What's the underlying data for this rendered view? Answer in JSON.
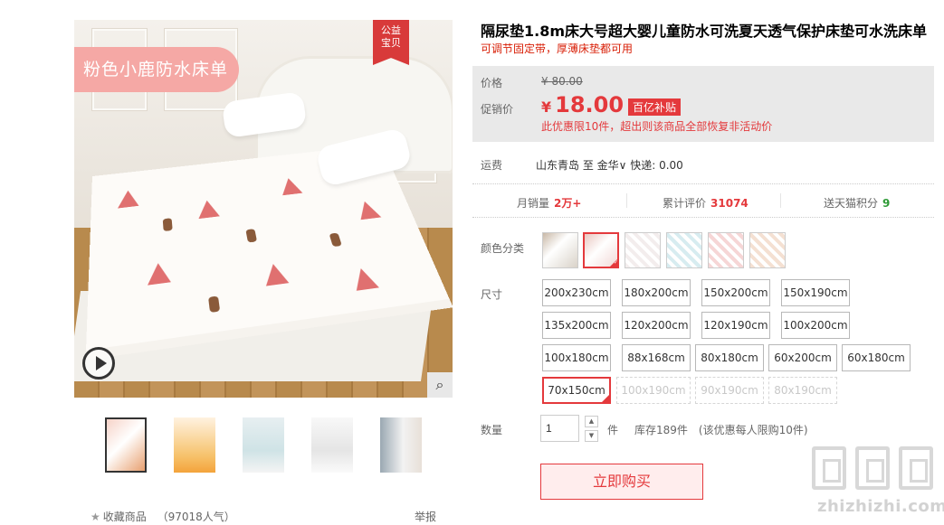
{
  "gallery": {
    "banner_text": "粉色小鹿防水床单",
    "charity_badge": [
      "公益",
      "宝贝"
    ],
    "thumbnails": 5,
    "active_thumbnail": 0,
    "favorite_label": "收藏商品",
    "favorite_count": "（97018人气）",
    "report_label": "举报",
    "play_icon": "play-icon",
    "zoom_icon": "magnifier-icon"
  },
  "product": {
    "title": "隔尿垫1.8m床大号超大婴儿童防水可洗夏天透气保护床垫可水洗床单",
    "subtitle": "可调节固定带，厚薄床垫都可用"
  },
  "price": {
    "orig_label": "价格",
    "orig_value": "¥ 80.00",
    "promo_label": "促销价",
    "currency": "¥",
    "promo_value": "18.00",
    "subsidy_badge": "百亿补贴",
    "limit_note": "此优惠限10件，超出则该商品全部恢复非活动价",
    "accent_color": "#e4393c"
  },
  "shipping": {
    "label": "运费",
    "text": "山东青岛 至 金华∨ 快递: 0.00"
  },
  "stats": [
    {
      "label": "月销量",
      "value": "2万+",
      "color": "red"
    },
    {
      "label": "累计评价",
      "value": "31074",
      "color": "red"
    },
    {
      "label": "送天猫积分",
      "value": "9",
      "color": "green"
    }
  ],
  "color": {
    "label": "颜色分类",
    "swatches": [
      "swatch-1",
      "swatch-2",
      "swatch-3",
      "swatch-4",
      "swatch-5",
      "swatch-6"
    ],
    "selected": 1
  },
  "size": {
    "label": "尺寸",
    "options": [
      {
        "text": "200x230cm",
        "state": "normal"
      },
      {
        "text": "180x200cm",
        "state": "normal"
      },
      {
        "text": "150x200cm",
        "state": "normal"
      },
      {
        "text": "150x190cm",
        "state": "normal"
      },
      {
        "text": "135x200cm",
        "state": "normal"
      },
      {
        "text": "120x200cm",
        "state": "normal"
      },
      {
        "text": "120x190cm",
        "state": "normal"
      },
      {
        "text": "100x200cm",
        "state": "normal"
      },
      {
        "text": "100x180cm",
        "state": "normal"
      },
      {
        "text": "88x168cm",
        "state": "normal"
      },
      {
        "text": "80x180cm",
        "state": "normal"
      },
      {
        "text": "60x200cm",
        "state": "normal"
      },
      {
        "text": "60x180cm",
        "state": "normal"
      },
      {
        "text": "70x150cm",
        "state": "selected"
      },
      {
        "text": "100x190cm",
        "state": "disabled"
      },
      {
        "text": "90x190cm",
        "state": "disabled"
      },
      {
        "text": "80x190cm",
        "state": "disabled"
      }
    ]
  },
  "quantity": {
    "label": "数量",
    "value": "1",
    "unit": "件",
    "stock": "库存189件　(该优惠每人限购10件)"
  },
  "buy_button": "立即购买",
  "watermark": "zhizhizhi.com"
}
